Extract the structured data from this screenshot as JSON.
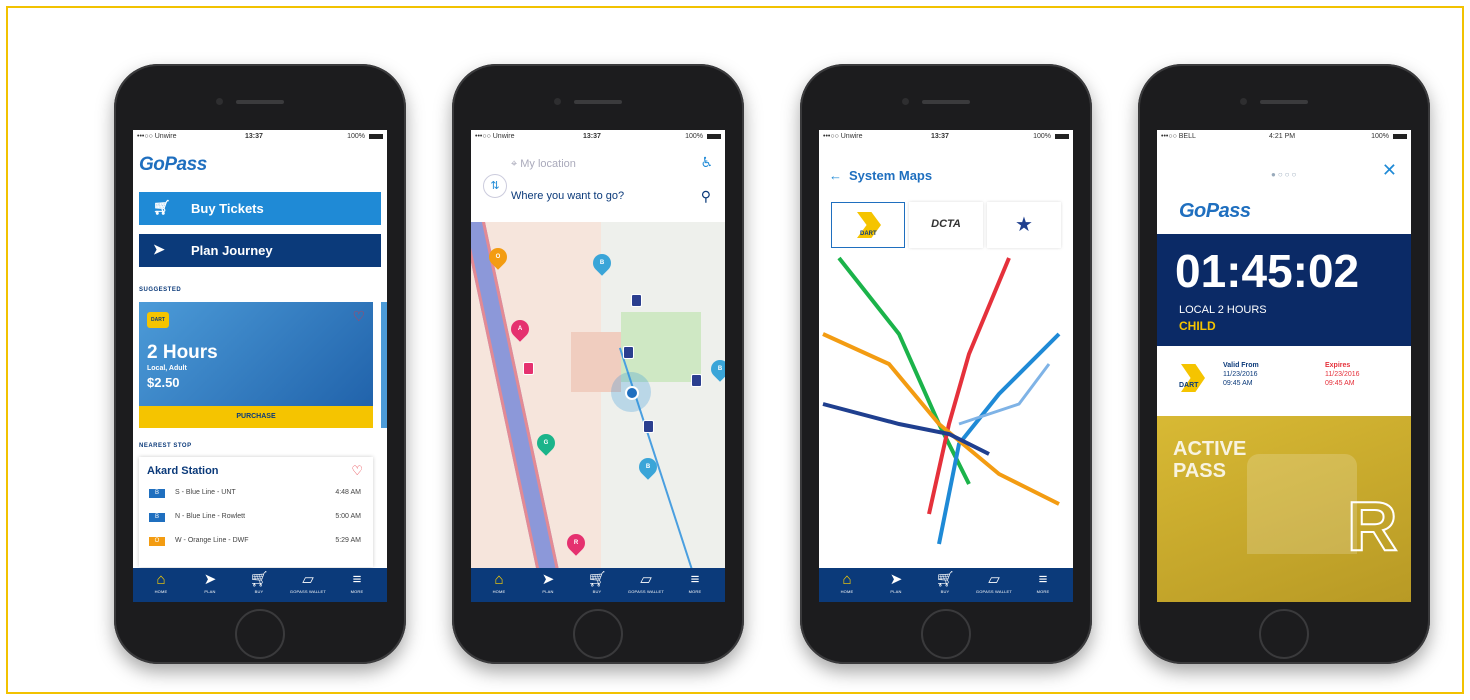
{
  "phone1": {
    "status": {
      "carrier": "•••○○ Unwire",
      "time": "13:37",
      "battery": "100%"
    },
    "logo": "GoPass",
    "buy_tickets": "Buy Tickets",
    "plan_journey": "Plan Journey",
    "suggested_label": "SUGGESTED",
    "ticket": {
      "title": "2 Hours",
      "subtitle": "Local, Adult",
      "price": "$2.50",
      "purchase": "PURCHASE",
      "operator": "DART"
    },
    "nearest_label": "NEAREST STOP",
    "station": "Akard Station",
    "departures": [
      {
        "tag": "B",
        "line": "S - Blue Line - UNT",
        "time": "4:48 AM",
        "color": "#1f6fbf"
      },
      {
        "tag": "B",
        "line": "N - Blue Line - Rowlett",
        "time": "5:00 AM",
        "color": "#1f6fbf"
      },
      {
        "tag": "O",
        "line": "W - Orange Line - DWF",
        "time": "5:29 AM",
        "color": "#f39c12"
      }
    ]
  },
  "phone2": {
    "status": {
      "carrier": "•••○○ Unwire",
      "time": "13:37",
      "battery": "100%"
    },
    "my_location": "My location",
    "destination_placeholder": "Where you want to go?"
  },
  "phone3": {
    "status": {
      "carrier": "•••○○ Unwire",
      "time": "13:37",
      "battery": "100%"
    },
    "title": "System Maps",
    "operators": [
      "DART",
      "DCTA",
      "TRE"
    ]
  },
  "phone4": {
    "status": {
      "carrier": "•••○○ BELL",
      "time": "4:21 PM",
      "battery": "100%"
    },
    "logo": "GoPass",
    "timer": "01:45:02",
    "pass_type": "LOCAL 2 HOURS",
    "rider": "CHILD",
    "valid_from_label": "Valid From",
    "valid_from_date": "11/23/2016",
    "valid_from_time": "09:45 AM",
    "expires_label": "Expires",
    "expires_date": "11/23/2016",
    "expires_time": "09:45 AM",
    "active_pass": "ACTIVE PASS",
    "operator": "DART",
    "big_letter": "R"
  },
  "tabbar": [
    {
      "icon": "home-icon",
      "label": "HOME"
    },
    {
      "icon": "plan-icon",
      "label": "PLAN"
    },
    {
      "icon": "buy-icon",
      "label": "BUY"
    },
    {
      "icon": "wallet-icon",
      "label": "GOPASS WALLET"
    },
    {
      "icon": "more-icon",
      "label": "MORE"
    }
  ],
  "colors": {
    "primary_blue": "#1f8ad6",
    "navy": "#0b3a7a",
    "gold": "#f5c400",
    "accent_red": "#e5313b"
  }
}
